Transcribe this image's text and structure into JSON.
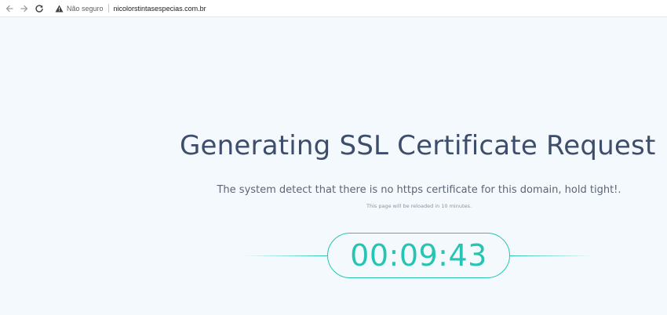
{
  "browser": {
    "security_label": "Não seguro",
    "url": "nicolorstintasespecias.com.br"
  },
  "main": {
    "title": "Generating SSL Certificate Request",
    "subtitle": "The system detect that there is no https certificate for this domain, hold tight!.",
    "note": "This page will be reloaded in 10 minutes.",
    "timer": "00:09:43"
  },
  "colors": {
    "accent": "#26c4b2",
    "title": "#3d4d6b",
    "background": "#f4f9fd"
  }
}
